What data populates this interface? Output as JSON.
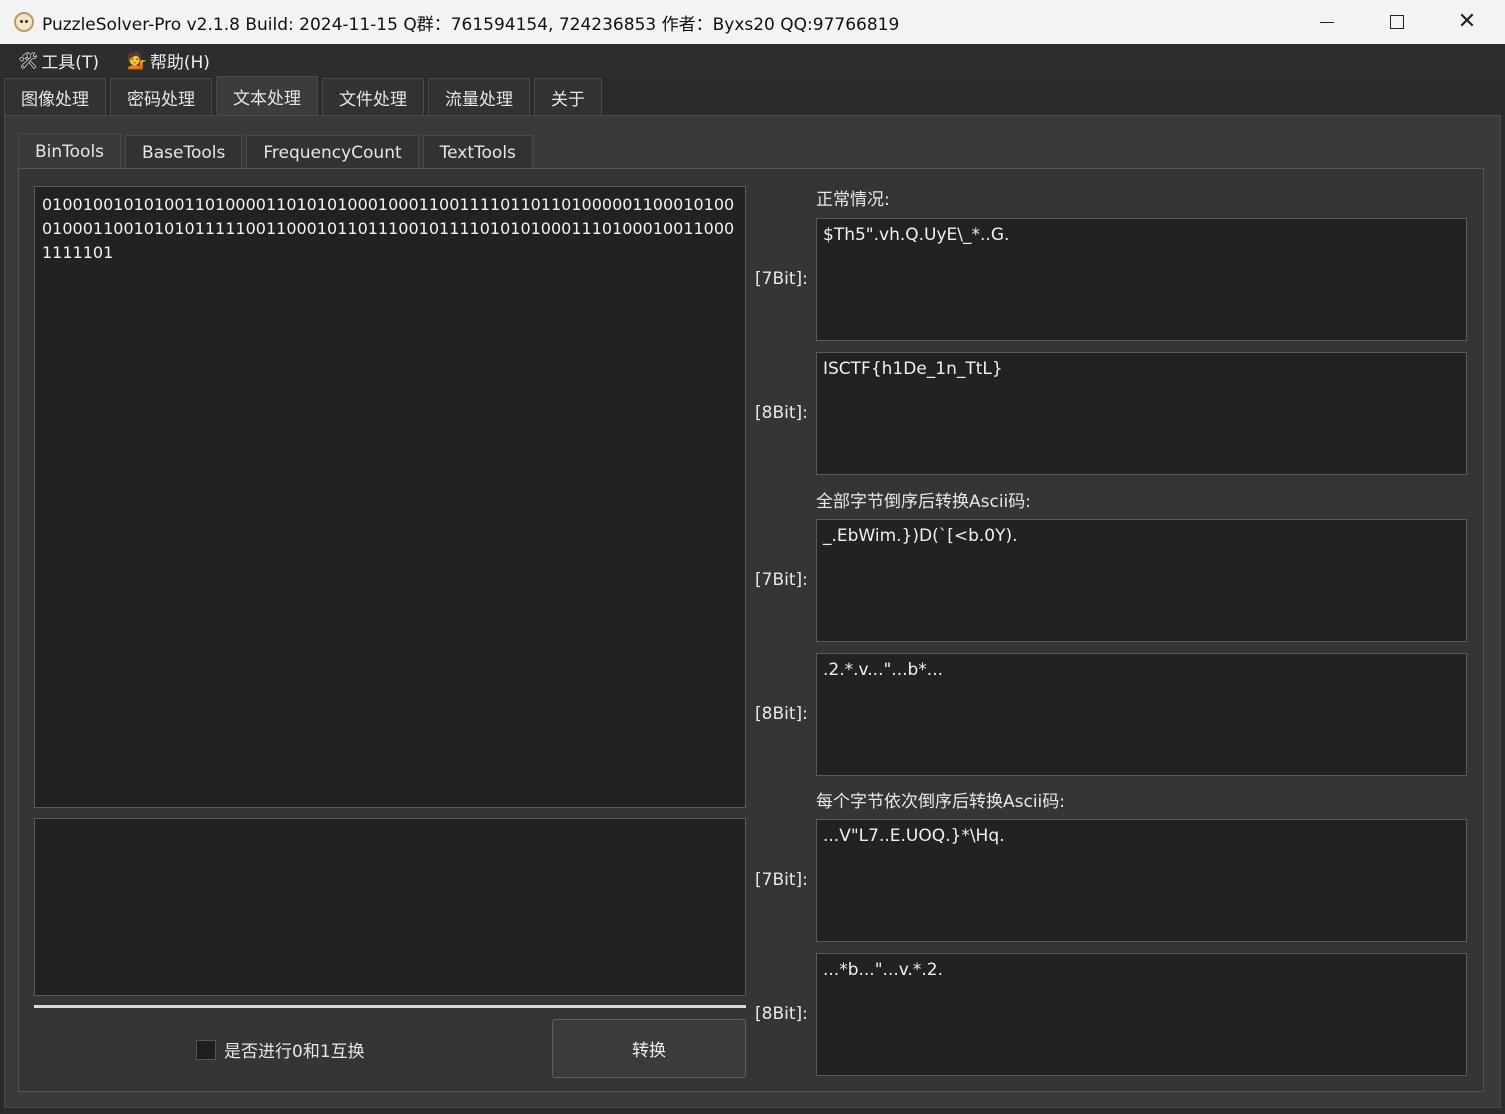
{
  "window": {
    "title": "PuzzleSolver-Pro v2.1.8  Build: 2024-11-15  Q群：761594154, 724236853  作者：Byxs20  QQ:97766819"
  },
  "menu": {
    "tools": "工具(T)",
    "help": "帮助(H)"
  },
  "top_tabs": [
    "图像处理",
    "密码处理",
    "文本处理",
    "文件处理",
    "流量处理",
    "关于"
  ],
  "inner_tabs": [
    "BinTools",
    "BaseTools",
    "FrequencyCount",
    "TextTools"
  ],
  "input_text": "0100100101010011010000110101010001000110011110110110100000110001010001000110010101011111001100010110111001011110101010001110100010011000111110 1",
  "input_text_display": "01001001010100110100001101010100010001100111101101101000001100010100010001100101010111110011000101101110010111101010100011101000100110001111101",
  "output_text": "",
  "swap_label": "是否进行0和1互换",
  "swap_checked": false,
  "convert_button": "转换",
  "sections": {
    "normal": {
      "title": "正常情况:",
      "bit7_label": "[7Bit]:",
      "bit7": "$Th5\".vh.Q.UyE\\_*..G.",
      "bit8_label": "[8Bit]:",
      "bit8": "ISCTF{h1De_1n_TtL}"
    },
    "reverse_all": {
      "title": "全部字节倒序后转换Ascii码:",
      "bit7_label": "[7Bit]:",
      "bit7": "_.EbWim.})D(`[<b.0Y).",
      "bit8_label": "[8Bit]:",
      "bit8": ".2.*.v...\"...b*..."
    },
    "reverse_each": {
      "title": "每个字节依次倒序后转换Ascii码:",
      "bit7_label": "[7Bit]:",
      "bit7": "...V\"L7..E.UOQ.}*\\Hq.",
      "bit8_label": "[8Bit]:",
      "bit8": "...*b...\"...v.*.2."
    }
  }
}
